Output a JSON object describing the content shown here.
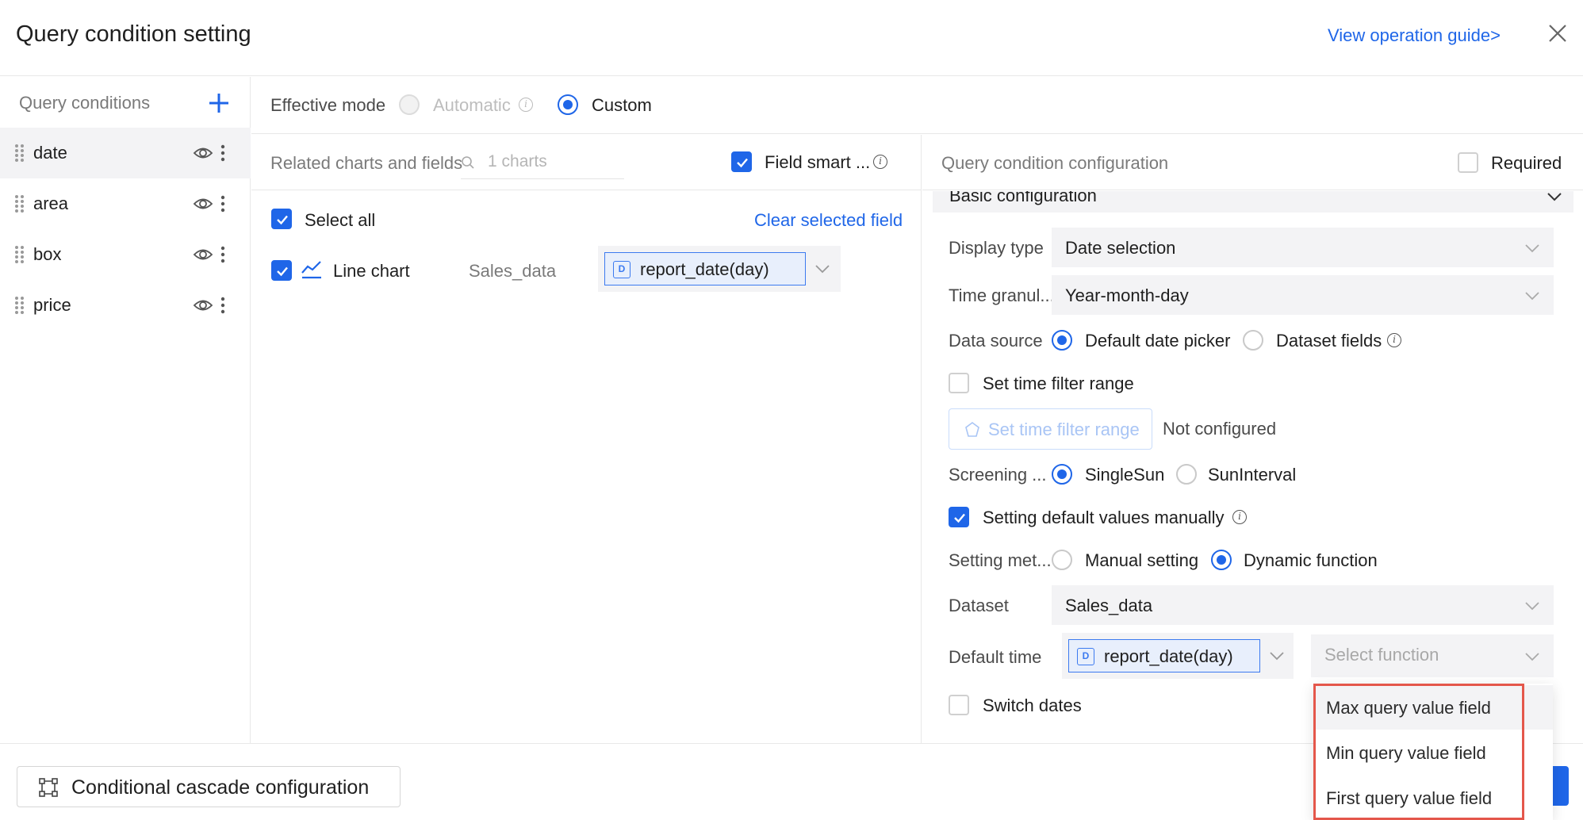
{
  "header": {
    "title": "Query condition setting",
    "guide_link": "View operation guide>"
  },
  "sidebar": {
    "title": "Query conditions",
    "items": [
      {
        "label": "date"
      },
      {
        "label": "area"
      },
      {
        "label": "box"
      },
      {
        "label": "price"
      }
    ]
  },
  "mode": {
    "label": "Effective mode",
    "options": [
      "Automatic",
      "Custom"
    ],
    "selected": "Custom"
  },
  "charts_panel": {
    "header_label": "Related charts and fields",
    "search_placeholder": "1 charts",
    "smart_label": "Field smart ...",
    "select_all": "Select all",
    "clear_link": "Clear selected field",
    "rows": [
      {
        "chart_name": "Line chart",
        "dataset": "Sales_data",
        "field": "report_date(day)"
      }
    ]
  },
  "config_panel": {
    "header_label": "Query condition configuration",
    "required_label": "Required",
    "section_title": "Basic configuration",
    "display_type": {
      "label": "Display type",
      "value": "Date selection"
    },
    "time_granularity": {
      "label": "Time granul...",
      "value": "Year-month-day"
    },
    "data_source": {
      "label": "Data source",
      "options": [
        "Default date picker",
        "Dataset fields"
      ],
      "selected": "Default date picker"
    },
    "time_filter_checkbox": "Set time filter range",
    "time_filter_button": "Set time filter range",
    "time_filter_status": "Not configured",
    "screening": {
      "label": "Screening ...",
      "options": [
        "SingleSun",
        "SunInterval"
      ],
      "selected": "SingleSun"
    },
    "default_manual": "Setting default values manually",
    "setting_method": {
      "label": "Setting met...",
      "options": [
        "Manual setting",
        "Dynamic function"
      ],
      "selected": "Dynamic function"
    },
    "dataset": {
      "label": "Dataset",
      "value": "Sales_data"
    },
    "default_time": {
      "label": "Default time",
      "field": "report_date(day)",
      "function_placeholder": "Select function"
    },
    "switch_dates": "Switch dates"
  },
  "dropdown": {
    "options": [
      "Max query value field",
      "Min query value field",
      "First query value field"
    ],
    "hovered": "Max query value field"
  },
  "footer": {
    "cascade_button": "Conditional cascade configuration"
  },
  "colors": {
    "accent": "#1f66e8",
    "highlight_border": "#e4574b",
    "tag_bg": "#e8effc"
  }
}
